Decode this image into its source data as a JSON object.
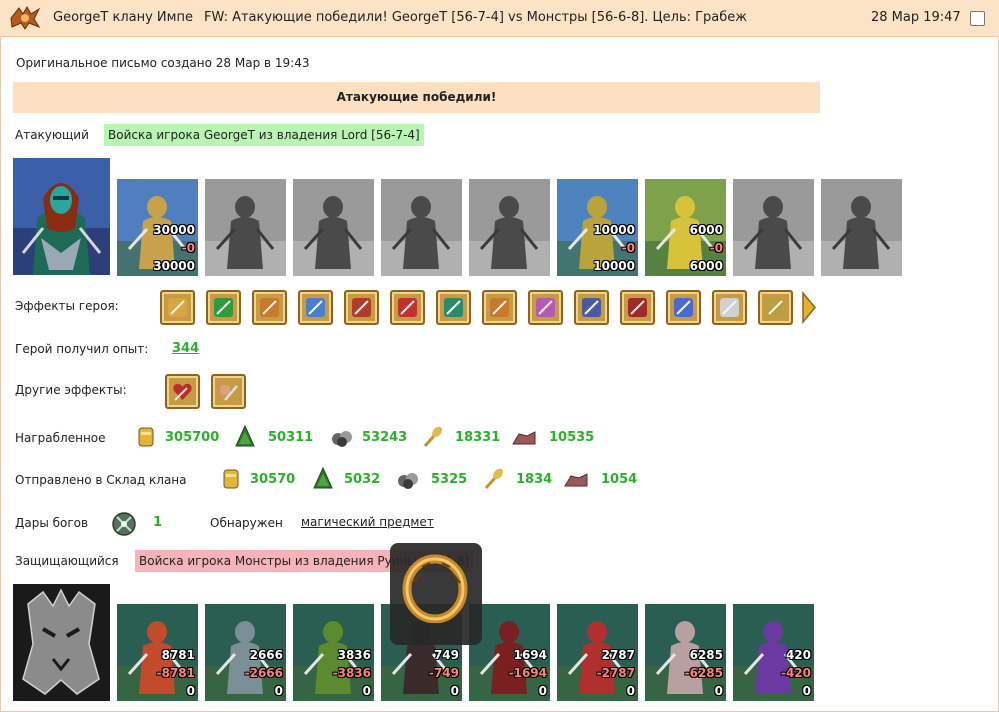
{
  "header": {
    "from": "GeorgeT клану Импе",
    "subject": "FW: Атакующие победили! GeorgeT [56-7-4] vs Монстры [56-6-8]. Цель: Грабеж",
    "time": "28 Мар 19:47",
    "logo_icon": "clan-crest-icon",
    "checkbox_icon": "select-checkbox"
  },
  "letter": {
    "original_note": "Оригинальное письмо создано 28 Мар в 19:43",
    "banner": "Атакующие победили!"
  },
  "attacker": {
    "label": "Атакующий",
    "army": "Войска игрока GeorgeT из владения Lord [56-7-4]",
    "units": [
      {
        "icon": "merchant-unit",
        "count": "30000",
        "loss": "-0",
        "left": "30000"
      },
      {
        "icon": "knight-unit-grey"
      },
      {
        "icon": "cavalry-unit-grey"
      },
      {
        "icon": "horseman-unit-grey"
      },
      {
        "icon": "pegasus-unit-grey"
      },
      {
        "icon": "crossbowman-unit",
        "count": "10000",
        "loss": "-0",
        "left": "10000"
      },
      {
        "icon": "mage-unit",
        "count": "6000",
        "loss": "-0",
        "left": "6000"
      },
      {
        "icon": "paladin-unit-grey"
      },
      {
        "icon": "angel-unit-grey"
      }
    ]
  },
  "hero_effects": {
    "label": "Эффекты героя:",
    "icons": [
      "gold-bag-icon",
      "sword-icon",
      "handshake-sword-icon",
      "magic-hand-icon",
      "castle-icon",
      "dice-icon",
      "shield-icon",
      "handshake-shield-icon",
      "wizard-icon",
      "amulet-icon",
      "demon-mask-icon",
      "ring-icon",
      "scroll-icon",
      "dagger-icon"
    ]
  },
  "experience": {
    "label": "Герой получил опыт:",
    "value": "344"
  },
  "other_effects": {
    "label": "Другие эффекты:",
    "icons": [
      "heart-sword-icon",
      "fist-sword-icon"
    ]
  },
  "loot": {
    "label": "Награбленное",
    "items": [
      {
        "icon": "gold-icon",
        "value": "305700"
      },
      {
        "icon": "wood-icon",
        "value": "50311"
      },
      {
        "icon": "ore-icon",
        "value": "53243"
      },
      {
        "icon": "wheat-icon",
        "value": "18331"
      },
      {
        "icon": "stone-icon",
        "value": "10535"
      }
    ]
  },
  "clan_store": {
    "label": "Отправлено в Склад клана",
    "items": [
      {
        "icon": "gold-icon",
        "value": "30570"
      },
      {
        "icon": "wood-icon",
        "value": "5032"
      },
      {
        "icon": "ore-icon",
        "value": "5325"
      },
      {
        "icon": "wheat-icon",
        "value": "1834"
      },
      {
        "icon": "stone-icon",
        "value": "1054"
      }
    ]
  },
  "gods": {
    "label": "Дары богов",
    "icon": "crystal-icon",
    "value": "1",
    "found_label": "Обнаружен",
    "found_link": "магический предмет"
  },
  "defender": {
    "label": "Защищающийся",
    "army": "Войска игрока Монстры из владения Руины [56-6-8]",
    "units": [
      {
        "icon": "lizard-warrior-unit",
        "count": "8781",
        "loss": "-8781",
        "left": "0"
      },
      {
        "icon": "golem-unit",
        "count": "2666",
        "loss": "-2666",
        "left": "0"
      },
      {
        "icon": "orc-shaman-unit",
        "count": "3836",
        "loss": "-3836",
        "left": "0"
      },
      {
        "icon": "dark-beast-unit",
        "count": "749",
        "loss": "-749",
        "left": "0"
      },
      {
        "icon": "spider-unit",
        "count": "1694",
        "loss": "-1694",
        "left": "0"
      },
      {
        "icon": "demon-unit",
        "count": "2787",
        "loss": "-2787",
        "left": "0"
      },
      {
        "icon": "titan-unit",
        "count": "6285",
        "loss": "-6285",
        "left": "0"
      },
      {
        "icon": "naga-unit",
        "count": "420",
        "loss": "-420",
        "left": "0"
      }
    ]
  },
  "tooltip": {
    "icon": "gold-ring-icon"
  }
}
